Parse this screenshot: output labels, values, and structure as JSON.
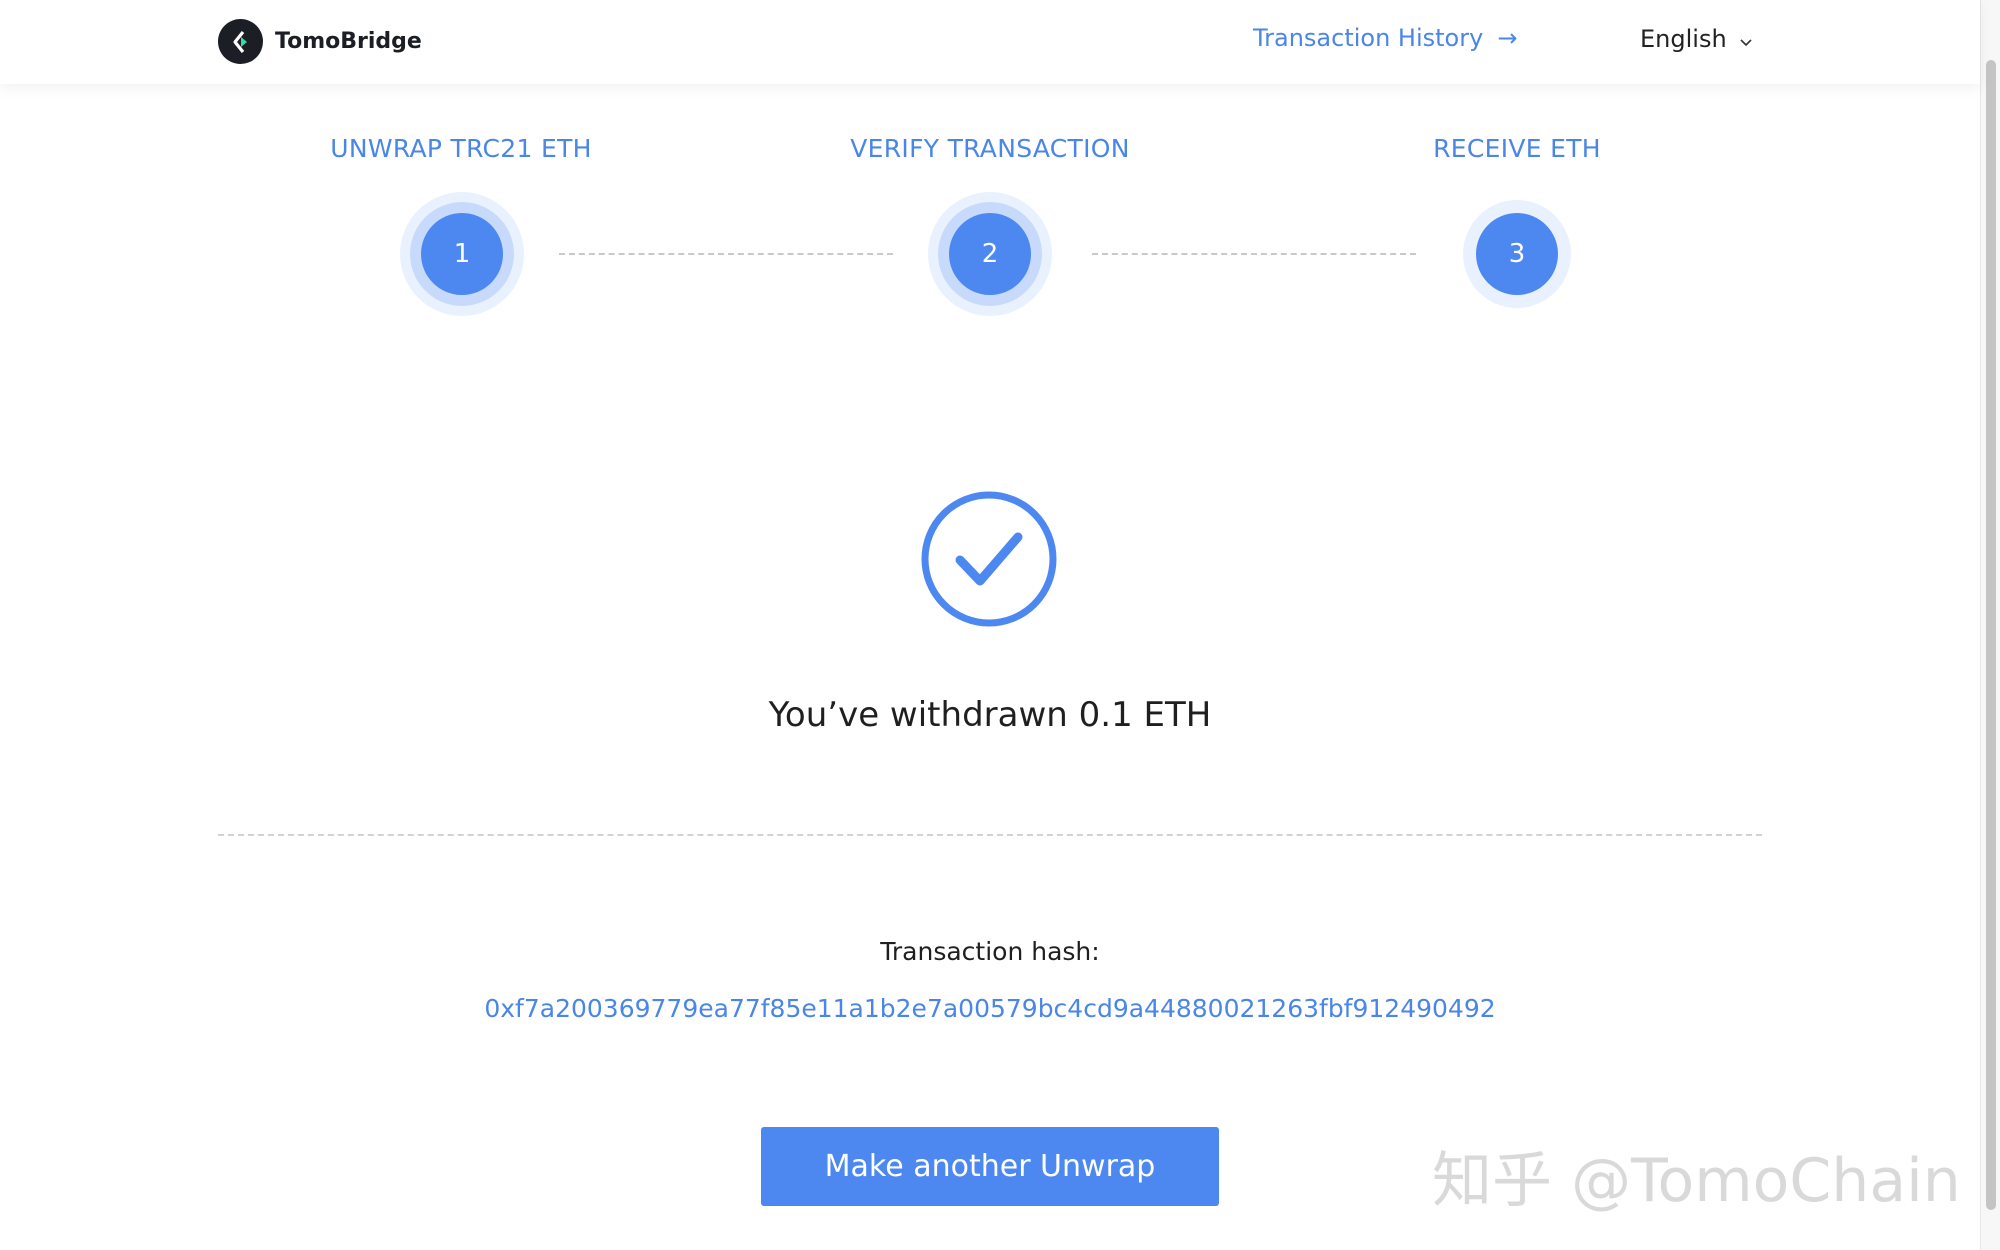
{
  "header": {
    "brand": "TomoBridge",
    "transaction_history_label": "Transaction History",
    "transaction_history_arrow": "→",
    "language_label": "English",
    "language_chevron": "⌄"
  },
  "steps": [
    {
      "label": "UNWRAP TRC21 ETH",
      "number": "1"
    },
    {
      "label": "VERIFY TRANSACTION",
      "number": "2"
    },
    {
      "label": "RECEIVE ETH",
      "number": "3"
    }
  ],
  "result": {
    "message": "You’ve withdrawn 0.1 ETH",
    "hash_label": "Transaction hash:",
    "hash_value": "0xf7a200369779ea77f85e11a1b2e7a00579bc4cd9a44880021263fbf912490492"
  },
  "actions": {
    "make_another_label": "Make another Unwrap"
  },
  "watermark": {
    "text": "知乎 @TomoChain"
  },
  "colors": {
    "accent": "#4d88f1",
    "link": "#4a86e8",
    "text": "#1f1f1f"
  },
  "icons": {
    "logo": "tomobridge-logo-icon",
    "success": "checkmark-circle-icon",
    "language": "chevron-down-icon",
    "history": "arrow-right-icon"
  }
}
